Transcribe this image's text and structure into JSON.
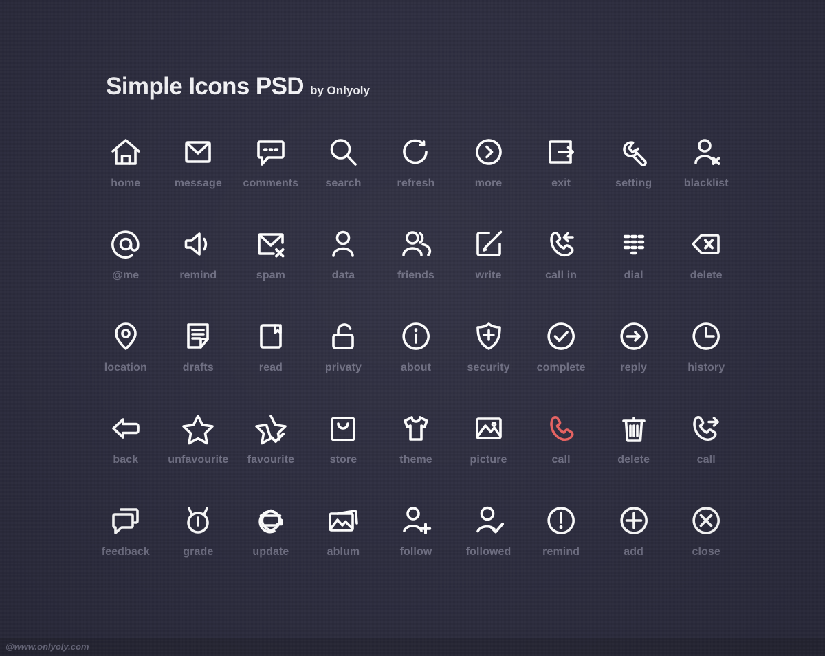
{
  "header": {
    "title": "Simple Icons PSD",
    "byline": "by Onlyoly"
  },
  "footer": {
    "text": "@www.onlyoly.com"
  },
  "colors": {
    "background": "#2b2b3d",
    "icon_stroke": "#ffffff",
    "label": "#6d6d81",
    "accent_red": "#e8605f",
    "footer_bar": "#252534"
  },
  "grid": {
    "columns": 9,
    "rows": 5
  },
  "icons": [
    {
      "label": "home",
      "icon": "home-icon",
      "color": "#ffffff"
    },
    {
      "label": "message",
      "icon": "envelope-icon",
      "color": "#ffffff"
    },
    {
      "label": "comments",
      "icon": "speech-bubble-dots-icon",
      "color": "#ffffff"
    },
    {
      "label": "search",
      "icon": "magnifier-icon",
      "color": "#ffffff"
    },
    {
      "label": "refresh",
      "icon": "refresh-arrow-icon",
      "color": "#ffffff"
    },
    {
      "label": "more",
      "icon": "chevron-right-circle-icon",
      "color": "#ffffff"
    },
    {
      "label": "exit",
      "icon": "exit-arrow-box-icon",
      "color": "#ffffff"
    },
    {
      "label": "setting",
      "icon": "wrench-icon",
      "color": "#ffffff"
    },
    {
      "label": "blacklist",
      "icon": "person-x-icon",
      "color": "#ffffff"
    },
    {
      "label": "@me",
      "icon": "at-sign-icon",
      "color": "#ffffff"
    },
    {
      "label": "remind",
      "icon": "speaker-icon",
      "color": "#ffffff"
    },
    {
      "label": "spam",
      "icon": "envelope-x-icon",
      "color": "#ffffff"
    },
    {
      "label": "data",
      "icon": "person-icon",
      "color": "#ffffff"
    },
    {
      "label": "friends",
      "icon": "people-icon",
      "color": "#ffffff"
    },
    {
      "label": "write",
      "icon": "pencil-square-icon",
      "color": "#ffffff"
    },
    {
      "label": "call in",
      "icon": "phone-incoming-icon",
      "color": "#ffffff"
    },
    {
      "label": "dial",
      "icon": "keypad-icon",
      "color": "#ffffff"
    },
    {
      "label": "delete",
      "icon": "backspace-icon",
      "color": "#ffffff"
    },
    {
      "label": "location",
      "icon": "map-pin-icon",
      "color": "#ffffff"
    },
    {
      "label": "drafts",
      "icon": "document-lines-icon",
      "color": "#ffffff"
    },
    {
      "label": "read",
      "icon": "book-bookmark-icon",
      "color": "#ffffff"
    },
    {
      "label": "privaty",
      "icon": "unlock-icon",
      "color": "#ffffff"
    },
    {
      "label": "about",
      "icon": "info-circle-icon",
      "color": "#ffffff"
    },
    {
      "label": "security",
      "icon": "shield-plus-icon",
      "color": "#ffffff"
    },
    {
      "label": "complete",
      "icon": "check-circle-icon",
      "color": "#ffffff"
    },
    {
      "label": "reply",
      "icon": "arrow-right-circle-icon",
      "color": "#ffffff"
    },
    {
      "label": "history",
      "icon": "clock-icon",
      "color": "#ffffff"
    },
    {
      "label": "back",
      "icon": "back-arrow-icon",
      "color": "#ffffff"
    },
    {
      "label": "unfavourite",
      "icon": "star-icon",
      "color": "#ffffff"
    },
    {
      "label": "favourite",
      "icon": "star-check-icon",
      "color": "#ffffff"
    },
    {
      "label": "store",
      "icon": "shopping-bag-icon",
      "color": "#ffffff"
    },
    {
      "label": "theme",
      "icon": "tshirt-icon",
      "color": "#ffffff"
    },
    {
      "label": "picture",
      "icon": "image-icon",
      "color": "#ffffff"
    },
    {
      "label": "call",
      "icon": "phone-icon",
      "color": "#e8605f"
    },
    {
      "label": "delete",
      "icon": "trash-icon",
      "color": "#ffffff"
    },
    {
      "label": "call",
      "icon": "phone-outgoing-icon",
      "color": "#ffffff"
    },
    {
      "label": "feedback",
      "icon": "double-chat-icon",
      "color": "#ffffff"
    },
    {
      "label": "grade",
      "icon": "alarm-clock-icon",
      "color": "#ffffff"
    },
    {
      "label": "update",
      "icon": "globe-refresh-icon",
      "color": "#ffffff"
    },
    {
      "label": "ablum",
      "icon": "stacked-images-icon",
      "color": "#ffffff"
    },
    {
      "label": "follow",
      "icon": "person-plus-icon",
      "color": "#ffffff"
    },
    {
      "label": "followed",
      "icon": "person-check-icon",
      "color": "#ffffff"
    },
    {
      "label": "remind",
      "icon": "exclamation-circle-icon",
      "color": "#ffffff"
    },
    {
      "label": "add",
      "icon": "plus-circle-icon",
      "color": "#ffffff"
    },
    {
      "label": "close",
      "icon": "x-circle-icon",
      "color": "#ffffff"
    }
  ]
}
